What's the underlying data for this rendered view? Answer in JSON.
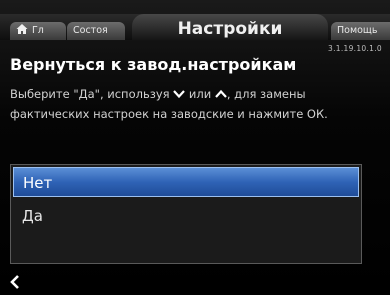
{
  "tabs": {
    "home": "Гл",
    "status": "Состоя",
    "active": "Настройки",
    "help": "Помощь"
  },
  "version": "3.1.19.10.1.0",
  "heading": "Вернуться к завод.настройкам",
  "description": {
    "part1": "Выберите \"Да\", используя",
    "part2": "или",
    "part3": ", для замены фактических настроек на заводские и нажмите ОК."
  },
  "options": [
    {
      "label": "Нет",
      "selected": true
    },
    {
      "label": "Да",
      "selected": false
    }
  ],
  "icons": {
    "home": "home-icon",
    "down": "chevron-down-icon",
    "up": "chevron-up-icon",
    "back": "back-arrow-icon"
  },
  "colors": {
    "selection": "#2f63b6",
    "background": "#000000"
  }
}
